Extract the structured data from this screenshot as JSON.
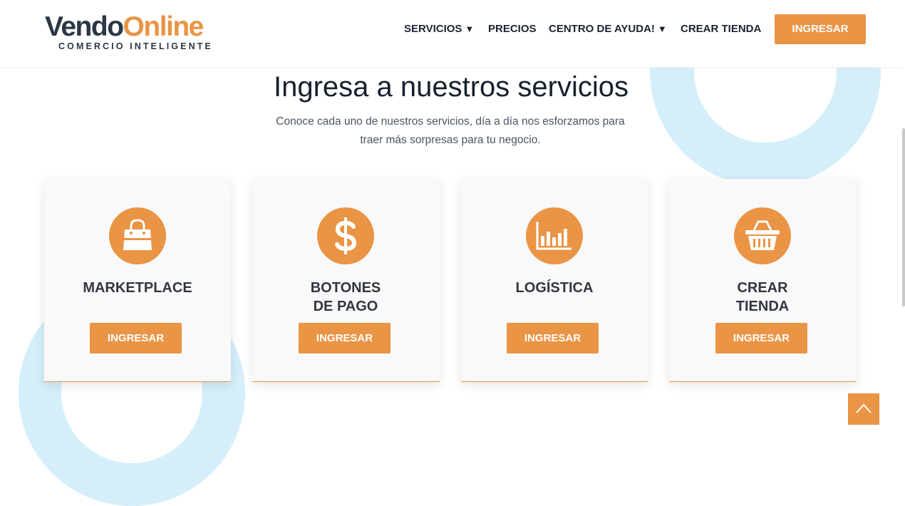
{
  "brand": {
    "name_part1": "Vendo",
    "name_part2": "Online",
    "tagline": "COMERCIO INTELIGENTE",
    "colors": {
      "accent": "#ea9445",
      "dark": "#2b3646",
      "ring": "#d4effa"
    }
  },
  "nav": {
    "items": [
      {
        "label": "SERVICIOS",
        "dropdown": true
      },
      {
        "label": "PRECIOS",
        "dropdown": false
      },
      {
        "label": "CENTRO DE AYUDA!",
        "dropdown": true
      },
      {
        "label": "CREAR TIENDA",
        "dropdown": false
      }
    ],
    "caret": "▼",
    "login_label": "INGRESAR"
  },
  "hero": {
    "title": "Ingresa a nuestros servicios",
    "subtitle_line1": "Conoce cada uno de nuestros servicios, día a día nos esforzamos para",
    "subtitle_line2": "traer más sorpresas para tu negocio."
  },
  "cards": [
    {
      "icon": "shopping-bag-icon",
      "title_line1": "MARKETPLACE",
      "title_line2": "",
      "button": "INGRESAR"
    },
    {
      "icon": "dollar-icon",
      "title_line1": "BOTONES",
      "title_line2": "DE PAGO",
      "button": "INGRESAR"
    },
    {
      "icon": "bar-chart-icon",
      "title_line1": "LOGÍSTICA",
      "title_line2": "",
      "button": "INGRESAR"
    },
    {
      "icon": "basket-icon",
      "title_line1": "CREAR",
      "title_line2": "TIENDA",
      "button": "INGRESAR"
    }
  ],
  "scroll_top_icon": "chevron-up-icon"
}
